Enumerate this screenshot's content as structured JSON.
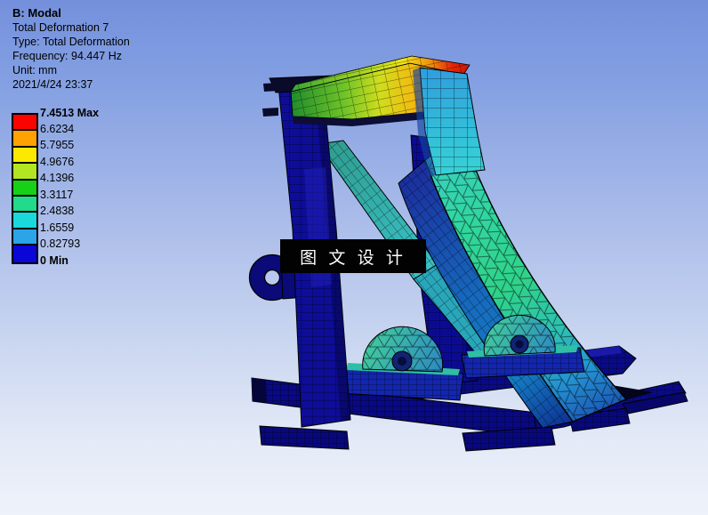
{
  "header": {
    "title": "B: Modal",
    "lines": [
      "Total Deformation 7",
      "Type: Total Deformation",
      "Frequency: 94.447 Hz",
      "Unit: mm",
      "2021/4/24 23:37"
    ]
  },
  "legend": {
    "labels": [
      "7.4513 Max",
      "6.6234",
      "5.7955",
      "4.9676",
      "4.1396",
      "3.3117",
      "2.4838",
      "1.6559",
      "0.82793",
      "0 Min"
    ],
    "colors": [
      "#fb0400",
      "#ffa202",
      "#fde800",
      "#b2e620",
      "#16d116",
      "#21da8b",
      "#19d9dc",
      "#2ba4e8",
      "#0a06d8"
    ]
  },
  "watermark": {
    "text": "图 文 设 计"
  },
  "scene": {
    "background_top": "#7490dc",
    "background_bottom": "#eef2fa",
    "mesh_line_color": "#000000",
    "base_structure_color": "#0a0a86"
  }
}
